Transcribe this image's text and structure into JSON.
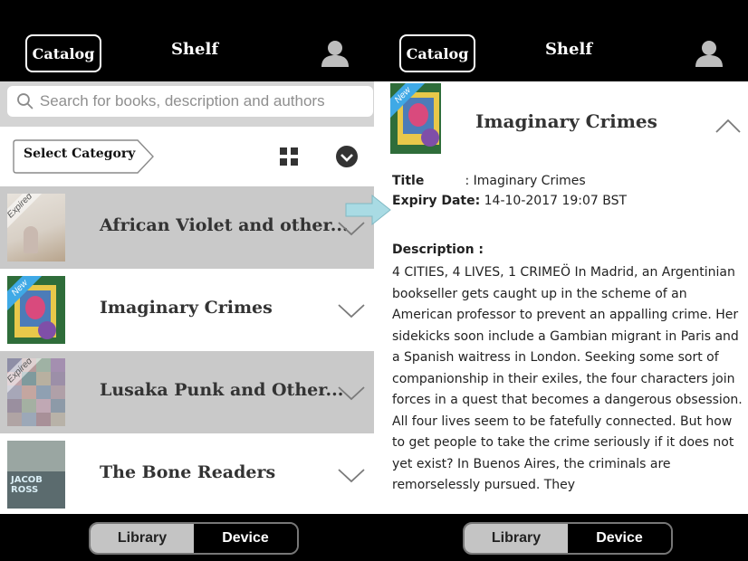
{
  "colors": {
    "topbar": "#000000",
    "search_bg": "#d4d4d4",
    "expired_row": "#c9c9c9",
    "new_ribbon": "#3fa9e6",
    "segment_active": "#c4c4c4",
    "arrow": "#a9dbe4"
  },
  "left": {
    "header": {
      "catalog_label": "Catalog",
      "title": "Shelf",
      "user_icon": "user-icon"
    },
    "search": {
      "placeholder": "Search for books, description and authors",
      "icon": "search-icon"
    },
    "category": {
      "select_label": "Select Category",
      "grid_icon": "grid-view-icon",
      "sort_icon": "chevron-down-circle-icon"
    },
    "books": [
      {
        "title": "African Violet and other...",
        "badge": "Expired",
        "expired": true
      },
      {
        "title": "Imaginary Crimes",
        "badge": "New",
        "expired": false
      },
      {
        "title": "Lusaka Punk and Other...",
        "badge": "Expired",
        "expired": true
      },
      {
        "title": "The Bone Readers",
        "badge": "",
        "expired": false,
        "cover_text": "JACOB ROSS"
      }
    ],
    "bottom": {
      "library": "Library",
      "device": "Device"
    }
  },
  "right": {
    "header": {
      "catalog_label": "Catalog",
      "title": "Shelf",
      "user_icon": "user-icon"
    },
    "book": {
      "title": "Imaginary Crimes",
      "badge": "New",
      "title_label": "Title",
      "title_value": ": Imaginary Crimes",
      "expiry_label": "Expiry Date:",
      "expiry_value": "14-10-2017 19:07 BST",
      "description_label": "Description :",
      "description": "4 CITIES, 4 LIVES, 1 CRIMEÖ In Madrid, an Argentinian bookseller gets caught up in the scheme of an American professor to prevent an appalling crime. Her sidekicks soon include a Gambian migrant in Paris and a Spanish waitress in London. Seeking some sort of companionship in their exiles, the four characters join forces in a quest that becomes a dangerous obsession. All four lives seem to be fatefully connected. But how to get people to take the crime seriously if it does not yet exist? In Buenos Aires, the criminals are remorselessly pursued. They"
    },
    "bottom": {
      "library": "Library",
      "device": "Device"
    }
  }
}
